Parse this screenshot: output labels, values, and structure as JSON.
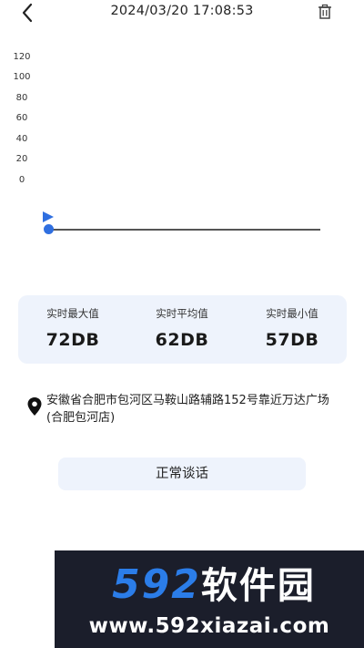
{
  "header": {
    "title": "2024/03/20 17:08:53",
    "back_icon": "chevron-left-icon",
    "delete_icon": "trash-icon"
  },
  "chart": {
    "y_ticks": [
      "120",
      "100",
      "80",
      "60",
      "40",
      "20",
      "0"
    ],
    "accent_color": "#2f6fe0",
    "play_icon": "play-icon"
  },
  "stats": {
    "max": {
      "label": "实时最大值",
      "value": "72DB"
    },
    "avg": {
      "label": "实时平均值",
      "value": "62DB"
    },
    "min": {
      "label": "实时最小值",
      "value": "57DB"
    }
  },
  "location": {
    "icon": "location-pin-icon",
    "address": "安徽省合肥市包河区马鞍山路辅路152号靠近万达广场(合肥包河店)"
  },
  "sound_type": {
    "label": "正常谈话"
  },
  "watermark": {
    "logo_number": "592",
    "logo_text": "软件园",
    "url": "www.592xiazai.com"
  }
}
